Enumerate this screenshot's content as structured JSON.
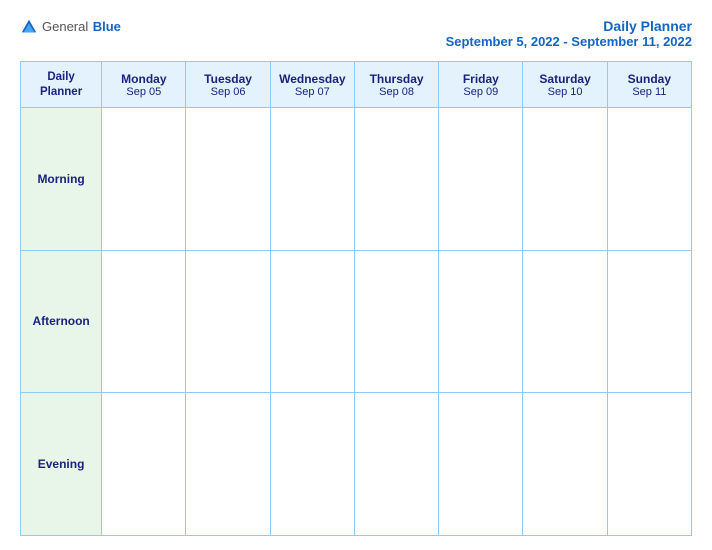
{
  "header": {
    "logo": {
      "general": "General",
      "blue": "Blue"
    },
    "title": "Daily Planner",
    "date_range": "September 5, 2022 - September 11, 2022"
  },
  "table": {
    "label_header_line1": "Daily",
    "label_header_line2": "Planner",
    "columns": [
      {
        "day": "Monday",
        "date": "Sep 05"
      },
      {
        "day": "Tuesday",
        "date": "Sep 06"
      },
      {
        "day": "Wednesday",
        "date": "Sep 07"
      },
      {
        "day": "Thursday",
        "date": "Sep 08"
      },
      {
        "day": "Friday",
        "date": "Sep 09"
      },
      {
        "day": "Saturday",
        "date": "Sep 10"
      },
      {
        "day": "Sunday",
        "date": "Sep 11"
      }
    ],
    "rows": [
      {
        "label": "Morning"
      },
      {
        "label": "Afternoon"
      },
      {
        "label": "Evening"
      }
    ]
  }
}
